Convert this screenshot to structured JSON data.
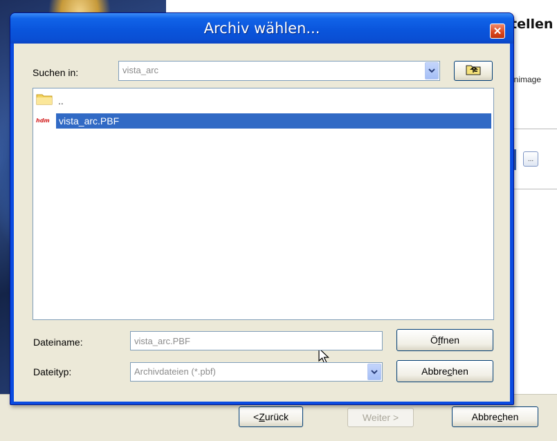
{
  "background_wizard": {
    "title_fragment": "tellen",
    "subtext_fragment": "enimage",
    "browse_label": "...",
    "footer": {
      "back_label_prefix": "<",
      "back_label_mnemonic": "Z",
      "back_label_rest": "urück",
      "next_label": "Weiter >",
      "cancel_label_prefix": "Abbre",
      "cancel_label_mnemonic": "c",
      "cancel_label_rest": "hen"
    }
  },
  "dialog": {
    "title": "Archiv wählen...",
    "close_glyph": "✕",
    "look_in": {
      "label": "Suchen in:",
      "value": "vista_arc"
    },
    "file_list": [
      {
        "label": "..",
        "icon": "folder-icon"
      },
      {
        "label": "vista_arc.PBF",
        "icon": "pbf-file-icon",
        "type_badge": "hdm",
        "selected": true
      }
    ],
    "filename": {
      "label": "Dateiname:",
      "value": "vista_arc.PBF"
    },
    "filetype": {
      "label": "Dateityp:",
      "value": "Archivdateien (*.pbf)"
    },
    "buttons": {
      "open": {
        "prefix": "Ö",
        "mnemonic": "f",
        "rest": "fnen"
      },
      "cancel": {
        "prefix": "Abbre",
        "mnemonic": "c",
        "rest": "hen"
      }
    }
  },
  "colors": {
    "title_bar": "#0a55dc",
    "selection": "#316ac5",
    "close_button": "#d9441c",
    "dialog_face": "#ece9d8"
  }
}
